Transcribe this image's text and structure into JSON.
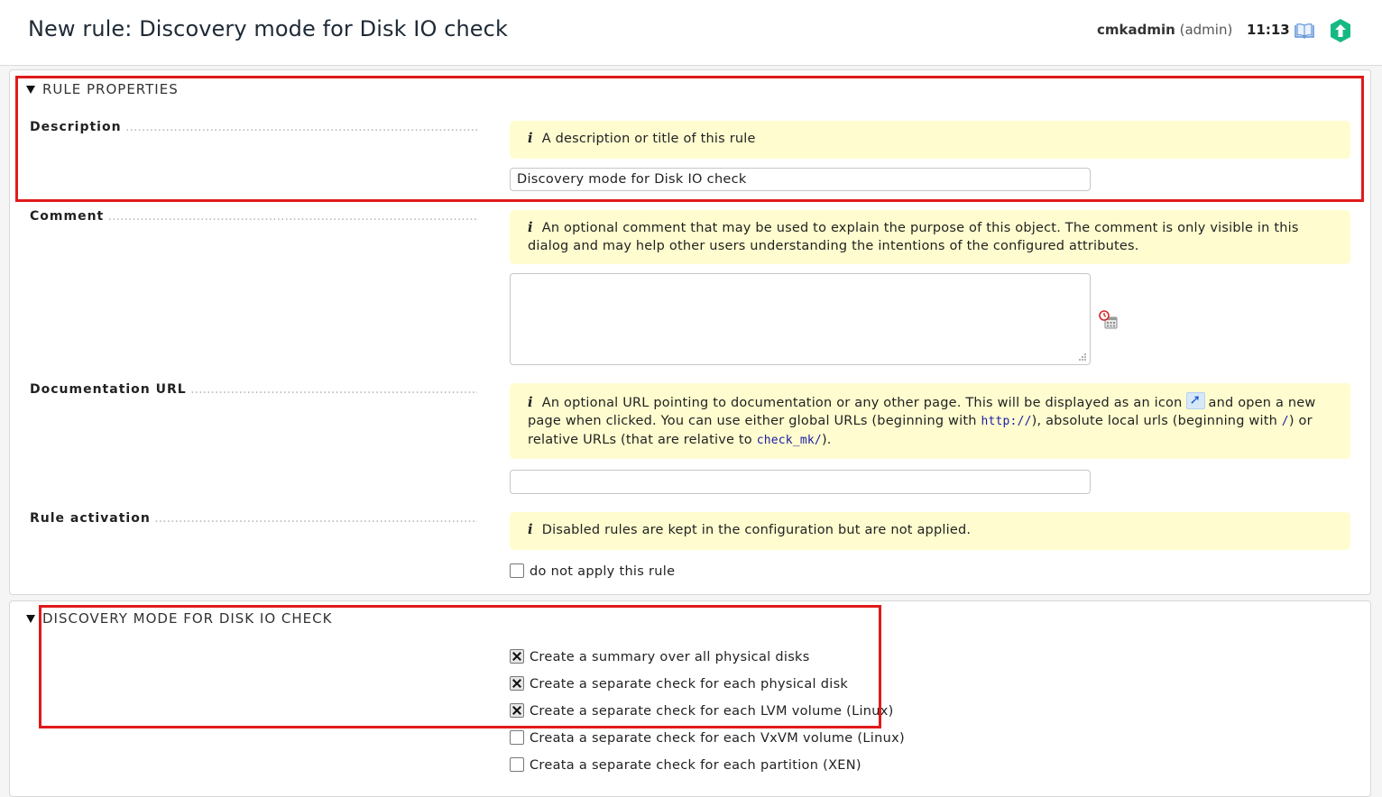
{
  "header": {
    "title": "New rule: Discovery mode for Disk IO check",
    "username": "cmkadmin",
    "role": "(admin)",
    "time": "11:13",
    "icons": [
      "book-icon",
      "update-icon"
    ]
  },
  "rule_properties": {
    "section_title": "RULE PROPERTIES",
    "description": {
      "label": "Description",
      "help": "A description or title of this rule",
      "value": "Discovery mode for Disk IO check"
    },
    "comment": {
      "label": "Comment",
      "help": "An optional comment that may be used to explain the purpose of this object. The comment is only visible in this dialog and may help other users understanding the intentions of the configured attributes.",
      "value": ""
    },
    "documentation_url": {
      "label": "Documentation URL",
      "help_part1": "An optional URL pointing to documentation or any other page. This will be displayed as an icon",
      "help_part2": "and open a new page when clicked. You can use either global URLs (beginning with",
      "code_http": "http://",
      "help_part3": "), absolute local urls (beginning with",
      "code_slash": "/",
      "help_part4": ") or relative URLs (that are relative to",
      "code_checkmk": "check_mk/",
      "help_part5": ").",
      "value": ""
    },
    "rule_activation": {
      "label": "Rule activation",
      "help": "Disabled rules are kept in the configuration but are not applied.",
      "checkbox_label": "do not apply this rule",
      "checked": false
    }
  },
  "discovery_mode": {
    "section_title": "DISCOVERY MODE FOR DISK IO CHECK",
    "options": [
      {
        "label": "Create a summary over all physical disks",
        "checked": true
      },
      {
        "label": "Create a separate check for each physical disk",
        "checked": true
      },
      {
        "label": "Create a separate check for each LVM volume (Linux)",
        "checked": true
      },
      {
        "label": "Creata a separate check for each VxVM volume (Linux)",
        "checked": false
      },
      {
        "label": "Creata a separate check for each partition (XEN)",
        "checked": false
      }
    ]
  },
  "colors": {
    "highlight_border": "#e01a1a",
    "help_background": "#fffdcf",
    "update_icon": "#16b981"
  }
}
